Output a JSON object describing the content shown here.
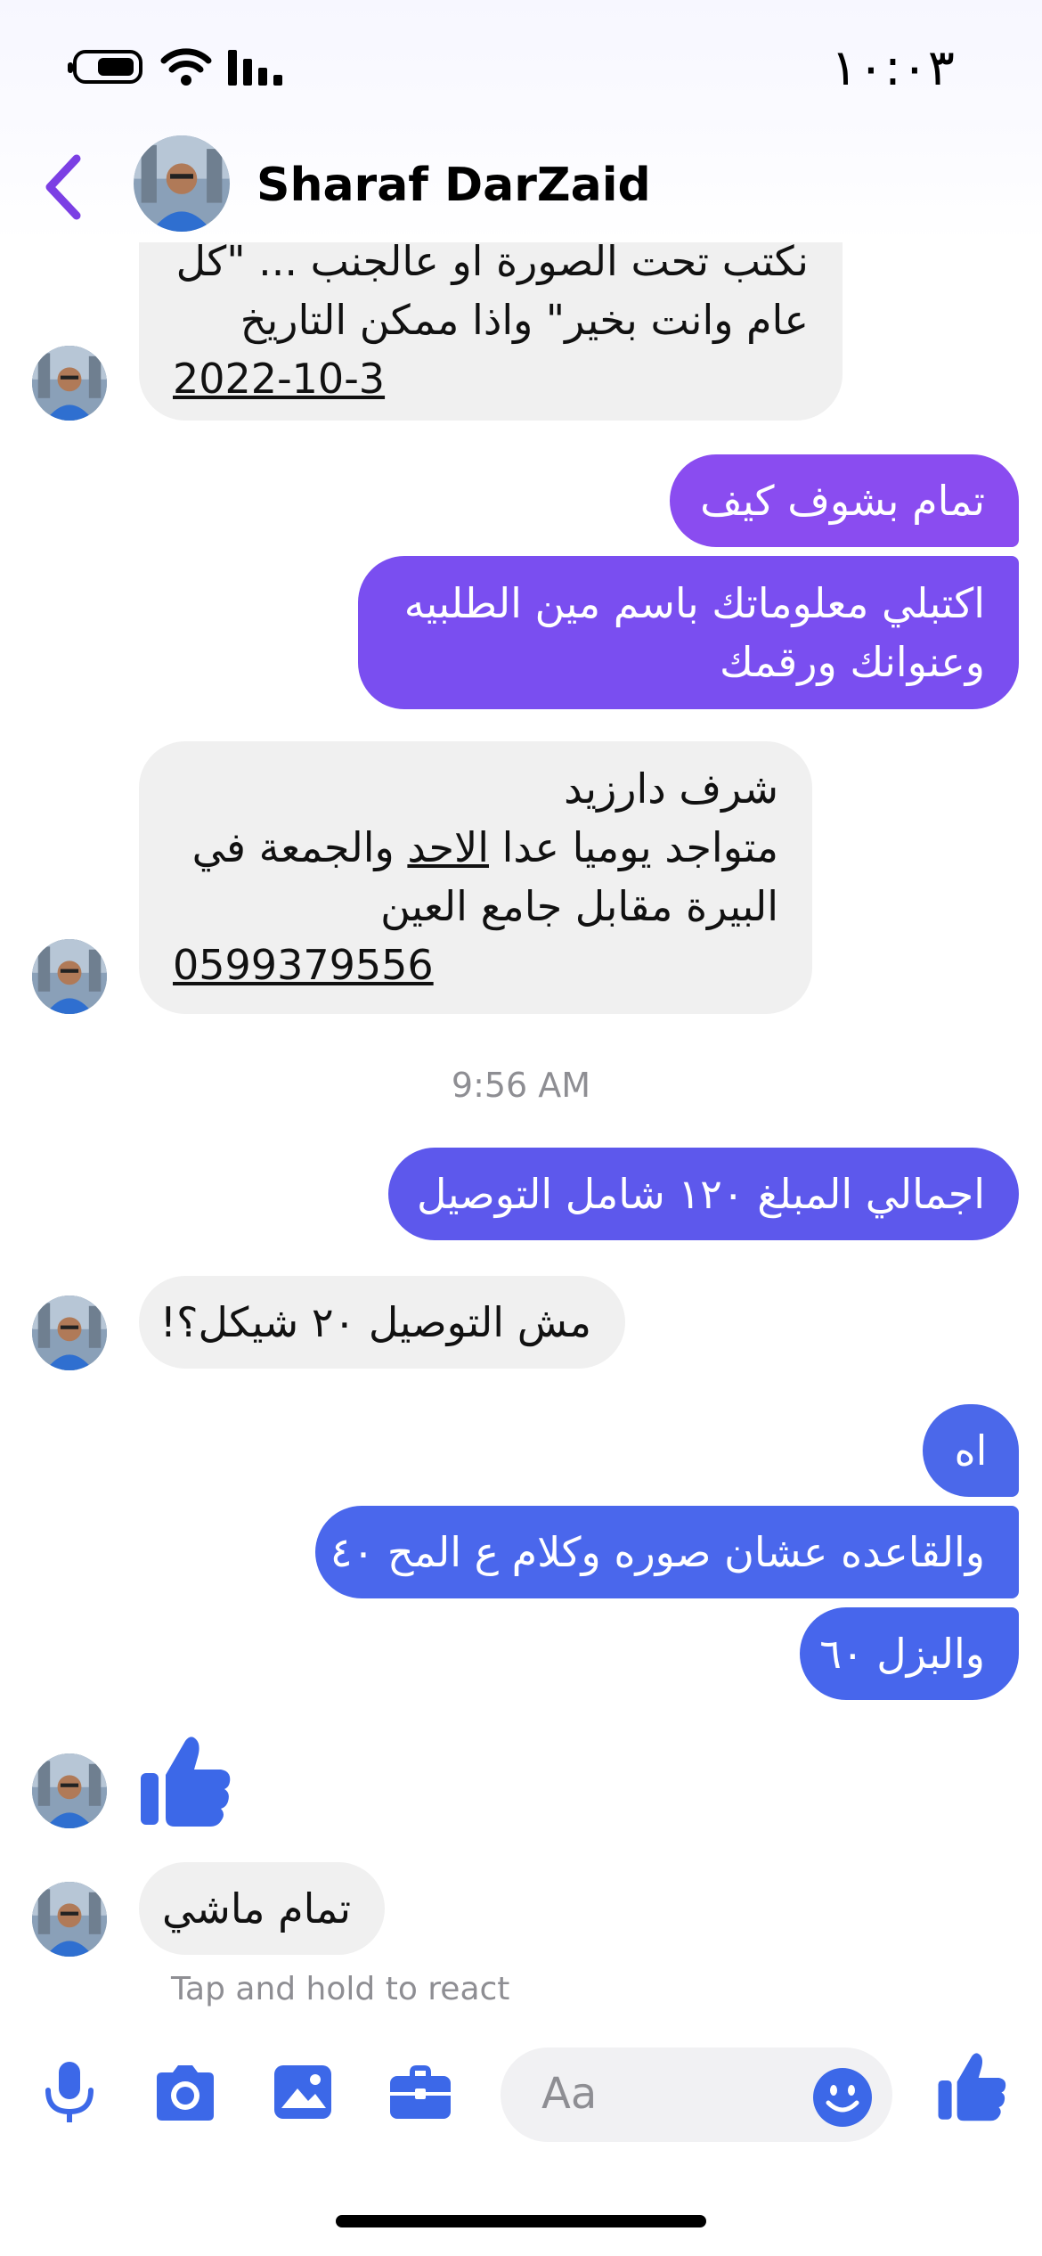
{
  "status_bar": {
    "time": "١٠:٠٣"
  },
  "header": {
    "contact_name": "Sharaf DarZaid"
  },
  "messages": {
    "m1": {
      "lines": [
        "نكتب تحت الصورة او عالجنب ... \"كل",
        "عام وانت بخير\" واذا ممكن التاريخ",
        "2022-10-3"
      ]
    },
    "m2": {
      "text": "تمام بشوف كيف"
    },
    "m3": {
      "lines": [
        "اكتبلي معلوماتك باسم مين الطلبيه",
        "وعنوانك ورقمك"
      ]
    },
    "m4": {
      "line1": "شرف دارزيد",
      "line2_a": "متواجد يوميا عدا ",
      "line2_b": "الاحد",
      "line2_c": " والجمعة في",
      "line3": "البيرة مقابل جامع العين",
      "line4": "0599379556"
    },
    "timestamp": "9:56 AM",
    "m5": {
      "text": "اجمالي المبلغ ١٢٠ شامل التوصيل"
    },
    "m6": {
      "text": "مش التوصيل ٢٠ شيكل؟!"
    },
    "m7": {
      "text": "اه"
    },
    "m8": {
      "text": "والقاعده عشان صوره وكلام ع المح ٤٠"
    },
    "m9": {
      "text": "والبزل ٦٠"
    },
    "m11": {
      "text": "تمام ماشي"
    }
  },
  "hint": "Tap and hold to react",
  "composer": {
    "placeholder": "Aa"
  },
  "icons": [
    "battery-icon",
    "wifi-icon",
    "signal-icon",
    "back-chevron-icon",
    "thumbs-up-icon",
    "microphone-icon",
    "camera-icon",
    "gallery-icon",
    "briefcase-icon",
    "emoji-icon",
    "like-send-icon"
  ],
  "colors": {
    "accent": "#7b3fe4",
    "sent_top": "#8a4cf0",
    "sent_bottom": "#4a67ec",
    "received": "#f0f0f0",
    "icon_blue": "#3c68e8"
  }
}
